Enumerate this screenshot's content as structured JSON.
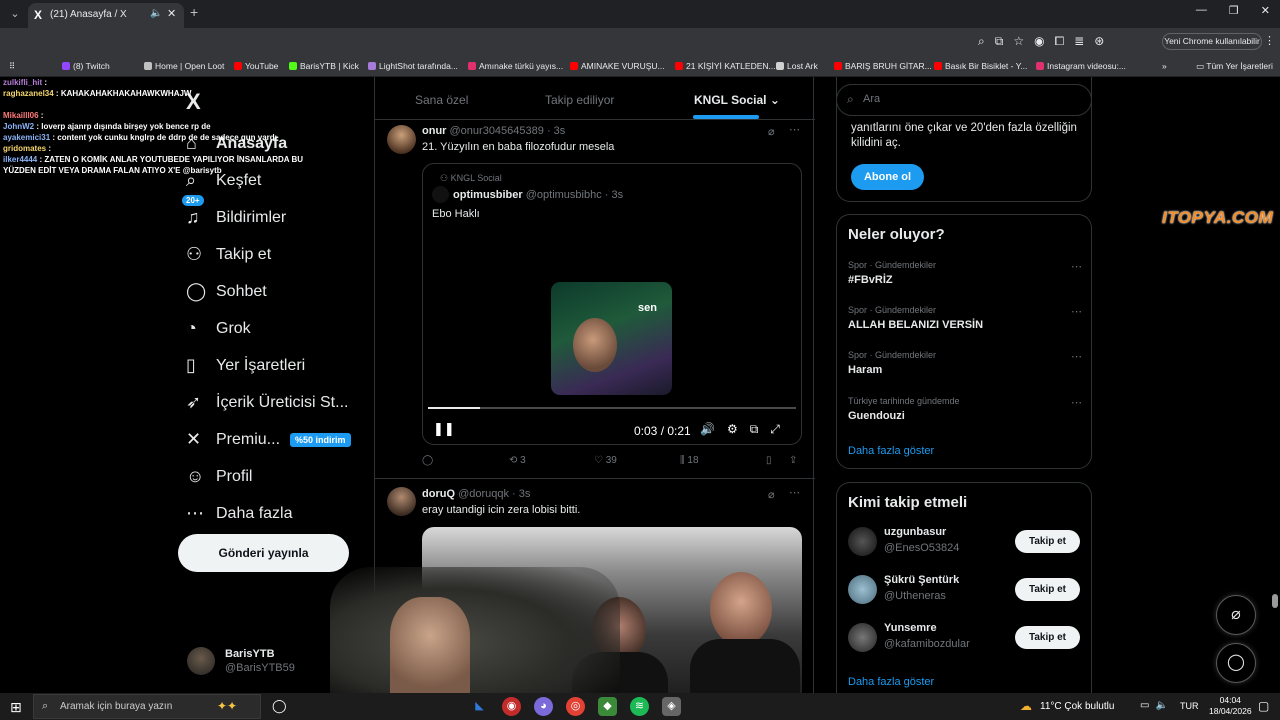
{
  "browser": {
    "tab_title": "(21) Anasayfa / X",
    "chrome_button": "Yeni Chrome kullanılabilir",
    "bookmarks": [
      {
        "label": "Home | Open Loot",
        "color": "#c0c0c0"
      },
      {
        "label": "YouTube",
        "color": "#ff0000"
      },
      {
        "label": "BarisYTB | Kick",
        "color": "#53fc18"
      },
      {
        "label": "LightShot tarafında...",
        "color": "#a77bd9"
      },
      {
        "label": "Amınake türkü yayıs...",
        "color": "#e1306c"
      },
      {
        "label": "AMINAKE VURUŞU...",
        "color": "#ff0000"
      },
      {
        "label": "21 KİŞİYİ KATLEDEN...",
        "color": "#ff0000"
      },
      {
        "label": "Lost Ark",
        "color": "#d0d0d0"
      },
      {
        "label": "BARIŞ BRUH GİTAR...",
        "color": "#ff0000"
      },
      {
        "label": "Basık Bir Bisiklet - Y...",
        "color": "#ff0000"
      },
      {
        "label": "Instagram videosu:...",
        "color": "#e1306c"
      }
    ],
    "bookmarks_all": "Tüm Yer İşaretleri",
    "bookmark_twitch": "(8) Twitch"
  },
  "chat": [
    {
      "user": "zulkifli_hit",
      "text": ""
    },
    {
      "user": "raghazanel34",
      "text": "KAHAKAHAKHAKAHAWKWHAJW"
    },
    {
      "user": "Mikailll06",
      "text": ""
    },
    {
      "user": "JohnW2",
      "text": "loverp ajanrp dışında birşey yok bence rp de"
    },
    {
      "user": "ayakemici31",
      "text": "content yok cunku knglrp de ddrp de de sadece gun vardı"
    },
    {
      "user": "gridomates",
      "text": ""
    },
    {
      "user": "ilker4444",
      "text": "ZATEN O KOMİK ANLAR YOUTUBEDE YAPILIYOR İNSANLARDA BU"
    },
    {
      "user": "",
      "text": "YÜZDEN EDİT VEYA DRAMA FALAN ATIYO X'E @barisytb"
    }
  ],
  "nav": {
    "logo": "X",
    "notif_badge": "20+",
    "premium_badge": "%50 indirim",
    "items": [
      {
        "label": "Anasayfa",
        "icon": "⌂"
      },
      {
        "label": "Keşfet",
        "icon": "⌕"
      },
      {
        "label": "Bildirimler",
        "icon": "♫"
      },
      {
        "label": "Takip et",
        "icon": "⚇"
      },
      {
        "label": "Sohbet",
        "icon": "◯"
      },
      {
        "label": "Grok",
        "icon": "◔"
      },
      {
        "label": "Yer İşaretleri",
        "icon": "▯"
      },
      {
        "label": "İçerik Üreticisi St...",
        "icon": "➶"
      },
      {
        "label": "Premiu...",
        "icon": "✕"
      },
      {
        "label": "Profil",
        "icon": "☺"
      },
      {
        "label": "Daha fazla",
        "icon": "⋯"
      }
    ],
    "post_button": "Gönderi yayınla",
    "me_name": "BarisYTB",
    "me_handle": "@BarisYTB59"
  },
  "feed_tabs": [
    "Sana özel",
    "Takip ediliyor",
    "KNGL Social"
  ],
  "tweets": [
    {
      "name": "onur",
      "handle": "@onur3045645389",
      "time": "3s",
      "text": "21. Yüzyılın en baba filozofudur mesela",
      "quote": {
        "context": "KNGL Social",
        "name": "optimusbiber",
        "handle": "@optimusbibhc",
        "time": "3s",
        "text": "Ebo Haklı",
        "video_caption": "sen",
        "time_display": "0:03 / 0:21",
        "progress": 0.14
      },
      "replies": "",
      "retweets": "3",
      "likes": "39",
      "views": "18"
    },
    {
      "name": "doruQ",
      "handle": "@doruqqk",
      "time": "3s",
      "text": "eray utandigi icin zera lobisi bitti."
    }
  ],
  "right": {
    "search_placeholder": "Ara",
    "premium_text": "yanıtlarını öne çıkar ve 20'den fazla özelliğin kilidini aç.",
    "subscribe": "Abone ol",
    "trends_title": "Neler oluyor?",
    "trends": [
      {
        "category": "Spor · Gündemdekiler",
        "name": "#FBvRİZ"
      },
      {
        "category": "Spor · Gündemdekiler",
        "name": "ALLAH BELANIZI VERSİN"
      },
      {
        "category": "Spor · Gündemdekiler",
        "name": "Haram"
      },
      {
        "category": "Türkiye tarihinde gündemde",
        "name": "Guendouzi"
      }
    ],
    "show_more": "Daha fazla göster",
    "follow_title": "Kimi takip etmeli",
    "follow": [
      {
        "name": "uzgunbasur",
        "handle": "@EnesO53824",
        "color": "#222"
      },
      {
        "name": "Şükrü Şentürk",
        "handle": "@Utheneras",
        "color": "#7aa0b0"
      },
      {
        "name": "Yunsemre",
        "handle": "@kafamibozdular",
        "color": "#444"
      }
    ],
    "follow_button": "Takip et",
    "show_more2": "Daha fazla göster"
  },
  "overlay_brand": "ITOPYA.COM",
  "taskbar": {
    "search_placeholder": "Aramak için buraya yazın",
    "weather": "11°C  Çok bulutlu",
    "lang": "TUR",
    "time": "04:04",
    "date": "18/04/2026"
  }
}
